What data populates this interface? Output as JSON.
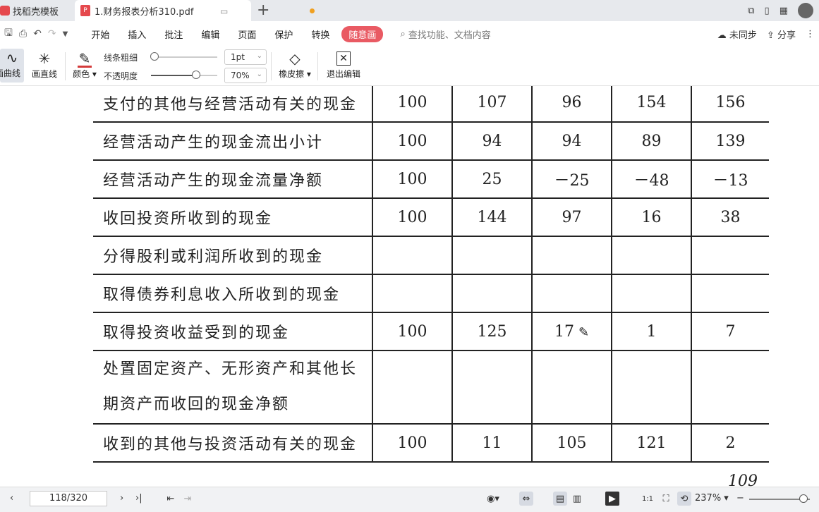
{
  "tabs": {
    "template_label": "找稻壳模板",
    "doc_label": "1.财务报表分析310.pdf"
  },
  "menu": {
    "items": [
      "开始",
      "插入",
      "批注",
      "编辑",
      "页面",
      "保护",
      "转换"
    ],
    "active_item": "随意画",
    "search_placeholder": "查找功能、文档内容",
    "sync_label": "未同步",
    "share_label": "分享"
  },
  "toolbar": {
    "curve_label": "画曲线",
    "line_label": "画直线",
    "color_label": "颜色",
    "stroke_label": "线条粗细",
    "stroke_value": "1pt",
    "opacity_label": "不透明度",
    "opacity_value": "70%",
    "eraser_label": "橡皮擦",
    "exit_label": "退出编辑"
  },
  "table": {
    "rows": [
      {
        "item": "支付的其他与经营活动有关的现金",
        "v": [
          "100",
          "107",
          "96",
          "154",
          "156"
        ]
      },
      {
        "item": "经营活动产生的现金流出小计",
        "v": [
          "100",
          "94",
          "94",
          "89",
          "139"
        ]
      },
      {
        "item": "经营活动产生的现金流量净额",
        "v": [
          "100",
          "25",
          "－25",
          "－48",
          "－13"
        ]
      },
      {
        "item": "收回投资所收到的现金",
        "v": [
          "100",
          "144",
          "97",
          "16",
          "38"
        ]
      },
      {
        "item": "分得股利或利润所收到的现金",
        "v": [
          "",
          "",
          "",
          "",
          ""
        ]
      },
      {
        "item": "取得债券利息收入所收到的现金",
        "v": [
          "",
          "",
          "",
          "",
          ""
        ]
      },
      {
        "item": "取得投资收益受到的现金",
        "v": [
          "100",
          "125",
          "17",
          "1",
          "7"
        ]
      },
      {
        "item": "处置固定资产、无形资产和其他长",
        "item2": "期资产而收回的现金净额",
        "v": [
          "",
          "",
          "",
          "",
          ""
        ]
      },
      {
        "item": "收到的其他与投资活动有关的现金",
        "v": [
          "100",
          "11",
          "105",
          "121",
          "2"
        ]
      }
    ],
    "page_number": "109"
  },
  "status": {
    "page_indicator": "118/320",
    "zoom": "237%"
  }
}
